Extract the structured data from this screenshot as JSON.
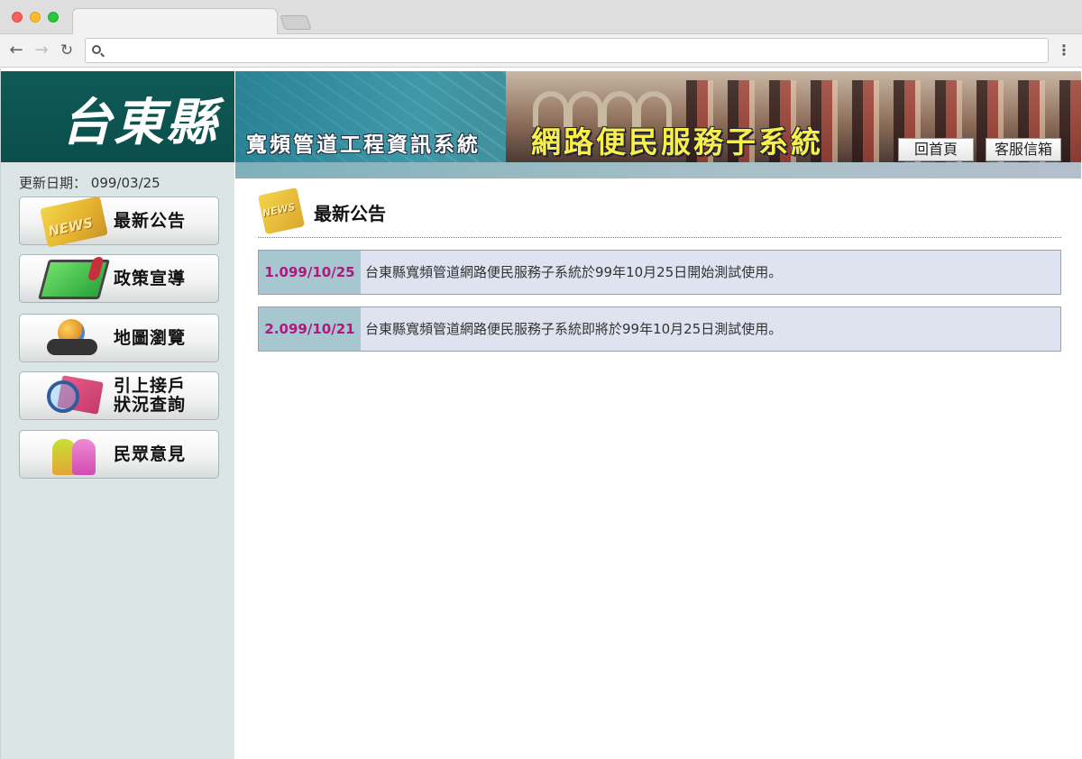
{
  "browser": {
    "tab_title": "",
    "url": "",
    "icons": [
      "back-arrow-icon",
      "forward-arrow-icon",
      "reload-icon",
      "search-icon",
      "menu-icon"
    ]
  },
  "header": {
    "logo_text": "台東縣",
    "title_small": "寬頻管道工程資訊系統",
    "title_big": "網路便民服務子系統",
    "buttons": {
      "home": "回首頁",
      "mail": "客服信箱"
    }
  },
  "sidebar": {
    "update_label": "更新日期：",
    "update_value": "099/03/25",
    "items": [
      {
        "label": "最新公告",
        "icon": "news-icon"
      },
      {
        "label": "政策宣導",
        "icon": "microphone-monitor-icon"
      },
      {
        "label": "地圖瀏覽",
        "icon": "globe-binoculars-icon"
      },
      {
        "label": "引上接戶\n狀況查詢",
        "icon": "magnifier-icon"
      },
      {
        "label": "民眾意見",
        "icon": "people-icon"
      }
    ]
  },
  "main": {
    "heading": "最新公告",
    "notices": [
      {
        "date": "1.099/10/25",
        "text": "台東縣寬頻管道網路便民服務子系統於99年10月25日開始測試使用。"
      },
      {
        "date": "2.099/10/21",
        "text": "台東縣寬頻管道網路便民服務子系統即將於99年10月25日測試使用。"
      }
    ]
  },
  "colors": {
    "logo_bg": "#0b4e4b",
    "sidebar_bg": "#dbe5e6",
    "notice_bg": "#dfe3ef",
    "date_bg": "#a6c7cf",
    "date_text": "#b0177f",
    "banner_title_big": "#f8ef4b"
  }
}
